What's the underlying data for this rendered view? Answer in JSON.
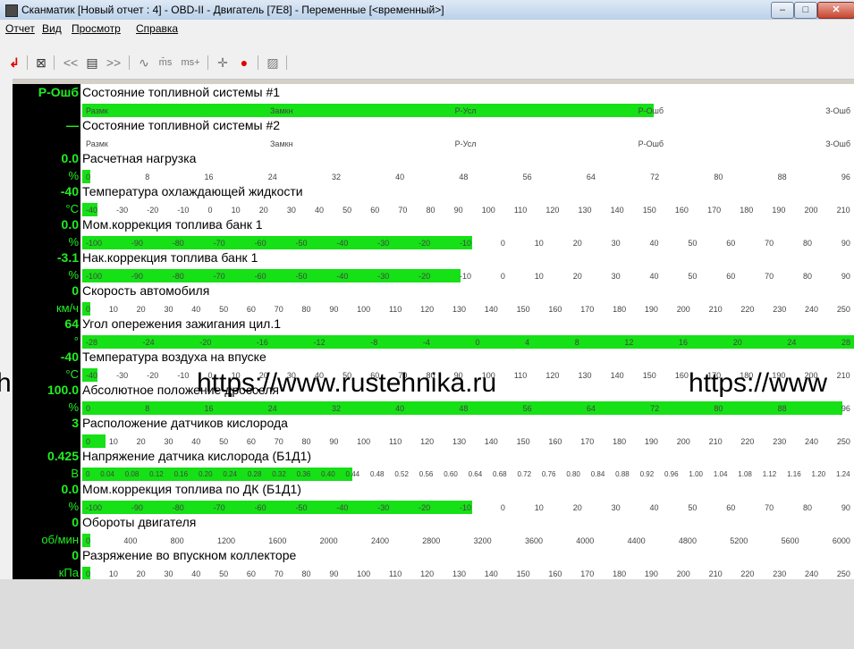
{
  "window": {
    "title": "Сканматик [Новый отчет : 4] - OBD-II - Двигатель [7E8] - Переменные [<временный>]",
    "close_glyph": "✕",
    "min_glyph": "–",
    "max_glyph": "□",
    "colors": {
      "bar_green": "#16e016",
      "value_text": "#22ee22",
      "value_bg": "#000000"
    }
  },
  "menu": [
    "Отчет",
    "Вид",
    "Просмотр",
    "Справка"
  ],
  "toolbar": {
    "icons": [
      "back-arrow-icon",
      "edit-icon",
      "prev-icon",
      "list-icon",
      "next-icon",
      "wave-icon",
      "ms-icon",
      "ms-plus-icon",
      "crosshair-icon",
      "record-icon",
      "save-icon"
    ],
    "labels": {
      "prev": "<<",
      "next": ">>",
      "list": "▤",
      "wave": "∿",
      "ms": "m̄s",
      "msplus": "ms+",
      "cross": "✛",
      "rec": "●",
      "save": "▨",
      "edit": "⊠",
      "back": "↲"
    }
  },
  "params": [
    {
      "value": "P-Ошб",
      "unit": "",
      "name": "Состояние топливной системы #1",
      "fill": 0.74,
      "ticks": [
        "Размк",
        "Замкн",
        "Р-Усл",
        "Р-Ошб",
        "З-Ошб"
      ]
    },
    {
      "value": "—",
      "unit": "",
      "name": "Состояние топливной системы #2",
      "fill": 0.0,
      "ticks": [
        "Размк",
        "Замкн",
        "Р-Усл",
        "Р-Ошб",
        "З-Ошб"
      ]
    },
    {
      "value": "0.0",
      "unit": "%",
      "name": "Расчетная нагрузка",
      "fill": 0.01,
      "ticks": [
        "0",
        "8",
        "16",
        "24",
        "32",
        "40",
        "48",
        "56",
        "64",
        "72",
        "80",
        "88",
        "96"
      ]
    },
    {
      "value": "-40",
      "unit": "°C",
      "name": "Температура охлаждающей жидкости",
      "fill": 0.02,
      "ticks": [
        "-40",
        "-30",
        "-20",
        "-10",
        "0",
        "10",
        "20",
        "30",
        "40",
        "50",
        "60",
        "70",
        "80",
        "90",
        "100",
        "110",
        "120",
        "130",
        "140",
        "150",
        "160",
        "170",
        "180",
        "190",
        "200",
        "210"
      ]
    },
    {
      "value": "0.0",
      "unit": "%",
      "name": "Мом.коррекция топлива банк 1",
      "fill": 0.505,
      "ticks": [
        "-100",
        "-90",
        "-80",
        "-70",
        "-60",
        "-50",
        "-40",
        "-30",
        "-20",
        "-10",
        "0",
        "10",
        "20",
        "30",
        "40",
        "50",
        "60",
        "70",
        "80",
        "90"
      ]
    },
    {
      "value": "-3.1",
      "unit": "%",
      "name": "Нак.коррекция топлива банк 1",
      "fill": 0.49,
      "ticks": [
        "-100",
        "-90",
        "-80",
        "-70",
        "-60",
        "-50",
        "-40",
        "-30",
        "-20",
        "-10",
        "0",
        "10",
        "20",
        "30",
        "40",
        "50",
        "60",
        "70",
        "80",
        "90"
      ]
    },
    {
      "value": "0",
      "unit": "км/ч",
      "name": "Скорость автомобиля",
      "fill": 0.01,
      "ticks": [
        "0",
        "10",
        "20",
        "30",
        "40",
        "50",
        "60",
        "70",
        "80",
        "90",
        "100",
        "110",
        "120",
        "130",
        "140",
        "150",
        "160",
        "170",
        "180",
        "190",
        "200",
        "210",
        "220",
        "230",
        "240",
        "250"
      ]
    },
    {
      "value": "64",
      "unit": "°",
      "name": "Угол опережения зажигания цил.1",
      "fill": 1.0,
      "ticks": [
        "-28",
        "-24",
        "-20",
        "-16",
        "-12",
        "-8",
        "-4",
        "0",
        "4",
        "8",
        "12",
        "16",
        "20",
        "24",
        "28"
      ]
    },
    {
      "value": "-40",
      "unit": "°C",
      "name": "Температура воздуха на впуске",
      "fill": 0.02,
      "ticks": [
        "-40",
        "-30",
        "-20",
        "-10",
        "0",
        "10",
        "20",
        "30",
        "40",
        "50",
        "60",
        "70",
        "80",
        "90",
        "100",
        "110",
        "120",
        "130",
        "140",
        "150",
        "160",
        "170",
        "180",
        "190",
        "200",
        "210"
      ]
    },
    {
      "value": "100.0",
      "unit": "%",
      "name": "Абсолютное положение дросселя",
      "fill": 0.985,
      "ticks": [
        "0",
        "8",
        "16",
        "24",
        "32",
        "40",
        "48",
        "56",
        "64",
        "72",
        "80",
        "88",
        "96"
      ]
    },
    {
      "value": "3",
      "unit": "",
      "name": "Расположение датчиков кислорода",
      "fill": 0.03,
      "ticks": [
        "0",
        "10",
        "20",
        "30",
        "40",
        "50",
        "60",
        "70",
        "80",
        "90",
        "100",
        "110",
        "120",
        "130",
        "140",
        "150",
        "160",
        "170",
        "180",
        "190",
        "200",
        "210",
        "220",
        "230",
        "240",
        "250"
      ]
    },
    {
      "value": "0.425",
      "unit": "В",
      "name": "Напряжение датчика кислорода (Б1Д1)",
      "fill": 0.35,
      "ticks": [
        "0",
        "0.04",
        "0.08",
        "0.12",
        "0.16",
        "0.20",
        "0.24",
        "0.28",
        "0.32",
        "0.36",
        "0.40",
        "0.44",
        "0.48",
        "0.52",
        "0.56",
        "0.60",
        "0.64",
        "0.68",
        "0.72",
        "0.76",
        "0.80",
        "0.84",
        "0.88",
        "0.92",
        "0.96",
        "1.00",
        "1.04",
        "1.08",
        "1.12",
        "1.16",
        "1.20",
        "1.24"
      ]
    },
    {
      "value": "0.0",
      "unit": "%",
      "name": "Мом.коррекция топлива по ДК (Б1Д1)",
      "fill": 0.505,
      "ticks": [
        "-100",
        "-90",
        "-80",
        "-70",
        "-60",
        "-50",
        "-40",
        "-30",
        "-20",
        "-10",
        "0",
        "10",
        "20",
        "30",
        "40",
        "50",
        "60",
        "70",
        "80",
        "90"
      ]
    },
    {
      "value": "0",
      "unit": "об/мин",
      "name": "Обороты двигателя",
      "fill": 0.01,
      "ticks": [
        "0",
        "400",
        "800",
        "1200",
        "1600",
        "2000",
        "2400",
        "2800",
        "3200",
        "3600",
        "4000",
        "4400",
        "4800",
        "5200",
        "5600",
        "6000"
      ]
    },
    {
      "value": "0",
      "unit": "кПа",
      "name": "Разряжение во впускном коллекторе",
      "fill": 0.01,
      "ticks": [
        "0",
        "10",
        "20",
        "30",
        "40",
        "50",
        "60",
        "70",
        "80",
        "90",
        "100",
        "110",
        "120",
        "130",
        "140",
        "150",
        "160",
        "170",
        "180",
        "190",
        "200",
        "210",
        "220",
        "230",
        "240",
        "250"
      ]
    }
  ],
  "watermark": [
    "https://www.rustehnika.ru",
    "https://www",
    "hi"
  ]
}
